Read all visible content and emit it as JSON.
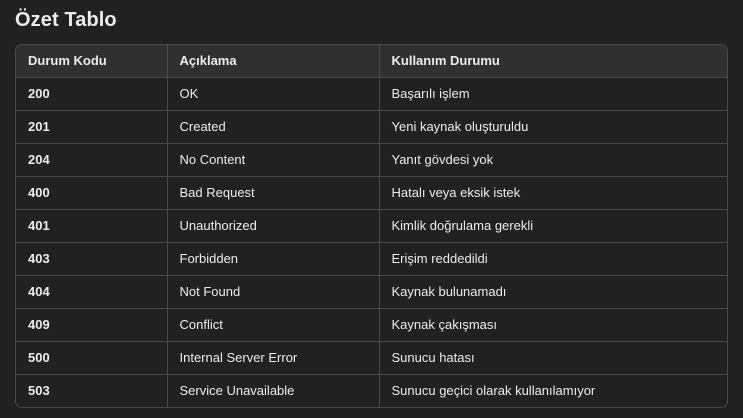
{
  "title": "Özet Tablo",
  "table": {
    "headers": [
      "Durum Kodu",
      "Açıklama",
      "Kullanım Durumu"
    ],
    "rows": [
      [
        "200",
        "OK",
        "Başarılı işlem"
      ],
      [
        "201",
        "Created",
        "Yeni kaynak oluşturuldu"
      ],
      [
        "204",
        "No Content",
        "Yanıt gövdesi yok"
      ],
      [
        "400",
        "Bad Request",
        "Hatalı veya eksik istek"
      ],
      [
        "401",
        "Unauthorized",
        "Kimlik doğrulama gerekli"
      ],
      [
        "403",
        "Forbidden",
        "Erişim reddedildi"
      ],
      [
        "404",
        "Not Found",
        "Kaynak bulunamadı"
      ],
      [
        "409",
        "Conflict",
        "Kaynak çakışması"
      ],
      [
        "500",
        "Internal Server Error",
        "Sunucu hatası"
      ],
      [
        "503",
        "Service Unavailable",
        "Sunucu geçici olarak kullanılamıyor"
      ]
    ]
  }
}
